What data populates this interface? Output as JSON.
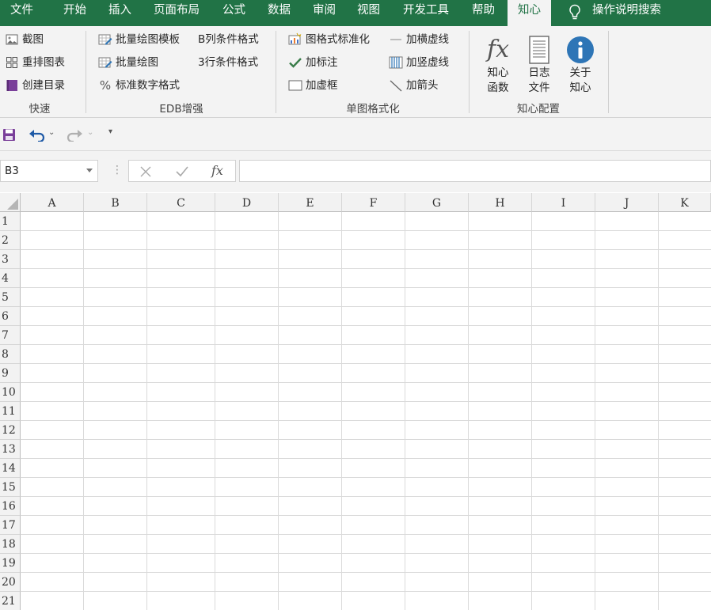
{
  "menu": {
    "tabs": [
      {
        "label": "文件"
      },
      {
        "label": "开始"
      },
      {
        "label": "插入"
      },
      {
        "label": "页面布局"
      },
      {
        "label": "公式"
      },
      {
        "label": "数据"
      },
      {
        "label": "审阅"
      },
      {
        "label": "视图"
      },
      {
        "label": "开发工具"
      },
      {
        "label": "帮助"
      },
      {
        "label": "知心"
      }
    ],
    "active_tab": "知心",
    "search_label": "操作说明搜索"
  },
  "ribbon": {
    "quick": {
      "label": "快速",
      "items": [
        "截图",
        "重排图表",
        "创建目录"
      ]
    },
    "edb": {
      "label": "EDB增强",
      "items": [
        "批量绘图模板",
        "批量绘图",
        "标准数字格式",
        "B列条件格式",
        "3行条件格式"
      ]
    },
    "format": {
      "label": "单图格式化",
      "items": [
        "图格式标准化",
        "加标注",
        "加虚框",
        "加横虚线",
        "加竖虚线",
        "加箭头"
      ]
    },
    "config": {
      "label": "知心配置",
      "buttons": [
        {
          "line1": "知心",
          "line2": "函数",
          "icon": "fx-icon"
        },
        {
          "line1": "日志",
          "line2": "文件",
          "icon": "document-icon"
        },
        {
          "line1": "关于",
          "line2": "知心",
          "icon": "info-icon"
        }
      ]
    }
  },
  "formula_bar": {
    "name_box": "B3",
    "fx_label": "fx",
    "formula": ""
  },
  "sheet": {
    "columns": [
      "A",
      "B",
      "C",
      "D",
      "E",
      "F",
      "G",
      "H",
      "I",
      "J",
      "K"
    ],
    "rows": [
      "1",
      "2",
      "3",
      "4",
      "5",
      "6",
      "7",
      "8",
      "9",
      "10",
      "11",
      "12",
      "13",
      "14",
      "15",
      "16",
      "17",
      "18",
      "19",
      "20",
      "21"
    ]
  },
  "colors": {
    "accent": "#217346",
    "ribbon_bg": "#f3f3f3",
    "save_icon": "#7a3f9a",
    "undo_icon": "#1f5aa6",
    "info_icon": "#2e75b6",
    "toc_icon": "#7a3f9a"
  }
}
